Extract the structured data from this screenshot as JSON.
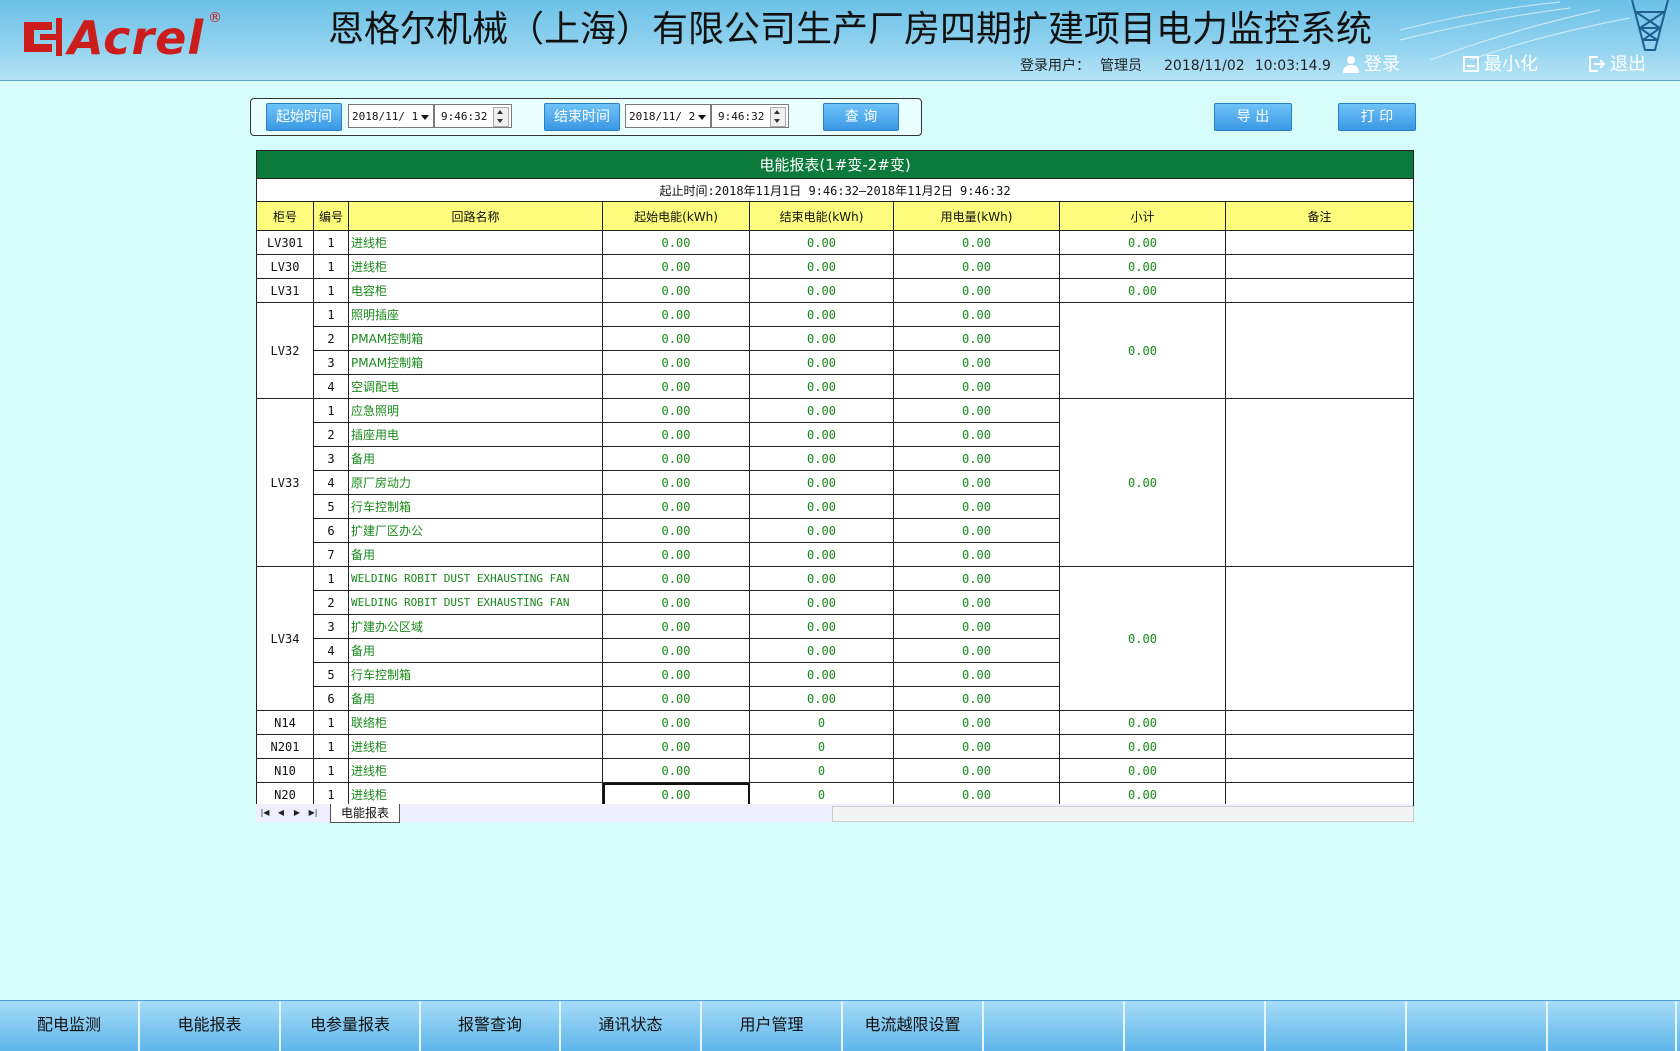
{
  "header": {
    "logo_text": "Acrel",
    "logo_reg": "®",
    "title": "恩格尔机械（上海）有限公司生产厂房四期扩建项目电力监控系统",
    "user_label": "登录用户：",
    "user_name": "管理员",
    "date": "2018/11/02",
    "time": "10:03:14.9",
    "login_label": "登录",
    "minimize_label": "最小化",
    "exit_label": "退出"
  },
  "query": {
    "start_label": "起始时间",
    "start_date": "2018/11/ 1",
    "start_time": "9:46:32",
    "end_label": "结束时间",
    "end_date": "2018/11/ 2",
    "end_time": "9:46:32",
    "query_label": "查 询",
    "export_label": "导 出",
    "print_label": "打 印"
  },
  "report": {
    "title": "电能报表(1#变-2#变)",
    "range": "起止时间:2018年11月1日 9:46:32—2018年11月2日 9:46:32",
    "headers": [
      "柜号",
      "编号",
      "回路名称",
      "起始电能(kWh)",
      "结束电能(kWh)",
      "用电量(kWh)",
      "小计",
      "备注"
    ],
    "groups": [
      {
        "cabinet": "LV301",
        "subtotal": "0.00",
        "rows": [
          {
            "no": "1",
            "name": "进线柜",
            "start": "0.00",
            "end": "0.00",
            "usage": "0.00"
          }
        ]
      },
      {
        "cabinet": "LV30",
        "subtotal": "0.00",
        "rows": [
          {
            "no": "1",
            "name": "进线柜",
            "start": "0.00",
            "end": "0.00",
            "usage": "0.00"
          }
        ]
      },
      {
        "cabinet": "LV31",
        "subtotal": "0.00",
        "rows": [
          {
            "no": "1",
            "name": "电容柜",
            "start": "0.00",
            "end": "0.00",
            "usage": "0.00"
          }
        ]
      },
      {
        "cabinet": "LV32",
        "subtotal": "0.00",
        "rows": [
          {
            "no": "1",
            "name": "照明插座",
            "start": "0.00",
            "end": "0.00",
            "usage": "0.00"
          },
          {
            "no": "2",
            "name": "PMAM控制箱",
            "start": "0.00",
            "end": "0.00",
            "usage": "0.00"
          },
          {
            "no": "3",
            "name": "PMAM控制箱",
            "start": "0.00",
            "end": "0.00",
            "usage": "0.00"
          },
          {
            "no": "4",
            "name": "空调配电",
            "start": "0.00",
            "end": "0.00",
            "usage": "0.00"
          }
        ]
      },
      {
        "cabinet": "LV33",
        "subtotal": "0.00",
        "rows": [
          {
            "no": "1",
            "name": "应急照明",
            "start": "0.00",
            "end": "0.00",
            "usage": "0.00"
          },
          {
            "no": "2",
            "name": "插座用电",
            "start": "0.00",
            "end": "0.00",
            "usage": "0.00"
          },
          {
            "no": "3",
            "name": "备用",
            "start": "0.00",
            "end": "0.00",
            "usage": "0.00"
          },
          {
            "no": "4",
            "name": "原厂房动力",
            "start": "0.00",
            "end": "0.00",
            "usage": "0.00"
          },
          {
            "no": "5",
            "name": "行车控制箱",
            "start": "0.00",
            "end": "0.00",
            "usage": "0.00"
          },
          {
            "no": "6",
            "name": "扩建厂区办公",
            "start": "0.00",
            "end": "0.00",
            "usage": "0.00"
          },
          {
            "no": "7",
            "name": "备用",
            "start": "0.00",
            "end": "0.00",
            "usage": "0.00"
          }
        ]
      },
      {
        "cabinet": "LV34",
        "subtotal": "0.00",
        "rows": [
          {
            "no": "1",
            "name": "WELDING ROBIT DUST EXHAUSTING FAN",
            "start": "0.00",
            "end": "0.00",
            "usage": "0.00"
          },
          {
            "no": "2",
            "name": "WELDING ROBIT DUST EXHAUSTING FAN",
            "start": "0.00",
            "end": "0.00",
            "usage": "0.00"
          },
          {
            "no": "3",
            "name": "扩建办公区域",
            "start": "0.00",
            "end": "0.00",
            "usage": "0.00"
          },
          {
            "no": "4",
            "name": "备用",
            "start": "0.00",
            "end": "0.00",
            "usage": "0.00"
          },
          {
            "no": "5",
            "name": "行车控制箱",
            "start": "0.00",
            "end": "0.00",
            "usage": "0.00"
          },
          {
            "no": "6",
            "name": "备用",
            "start": "0.00",
            "end": "0.00",
            "usage": "0.00"
          }
        ]
      },
      {
        "cabinet": "N14",
        "subtotal": "0.00",
        "rows": [
          {
            "no": "1",
            "name": "联络柜",
            "start": "0.00",
            "end": "0",
            "usage": "0.00"
          }
        ]
      },
      {
        "cabinet": "N201",
        "subtotal": "0.00",
        "rows": [
          {
            "no": "1",
            "name": "进线柜",
            "start": "0.00",
            "end": "0",
            "usage": "0.00"
          }
        ]
      },
      {
        "cabinet": "N10",
        "subtotal": "0.00",
        "rows": [
          {
            "no": "1",
            "name": "进线柜",
            "start": "0.00",
            "end": "0",
            "usage": "0.00"
          }
        ]
      },
      {
        "cabinet": "N20",
        "subtotal": "0.00",
        "rows": [
          {
            "no": "1",
            "name": "进线柜",
            "start": "0.00",
            "end": "0",
            "usage": "0.00"
          }
        ]
      }
    ]
  },
  "sheet": {
    "tab_label": "电能报表"
  },
  "bottom_nav": {
    "items": [
      "配电监测",
      "电能报表",
      "电参量报表",
      "报警查询",
      "通讯状态",
      "用户管理",
      "电流越限设置",
      "",
      "",
      "",
      "",
      ""
    ]
  },
  "colors": {
    "header_bg": "#8fd1ef",
    "page_bg": "#d6fdfb",
    "title_bar": "#0c7a3a",
    "table_header": "#fefc7c",
    "value_text": "#1a8a1a",
    "button_blue": "#3a98e4"
  }
}
